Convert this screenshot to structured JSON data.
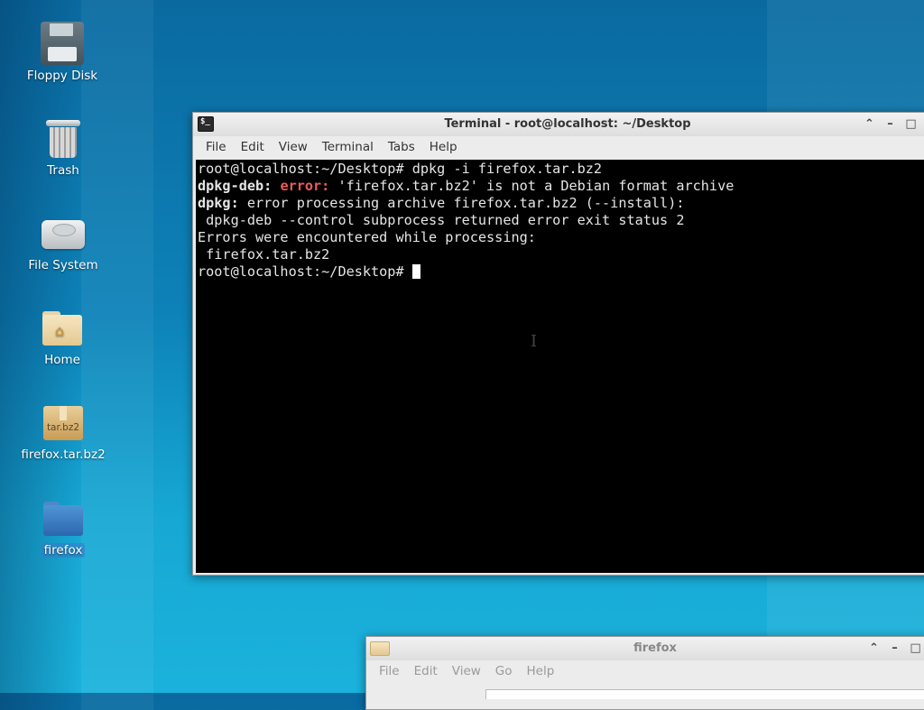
{
  "desktop": {
    "icons": [
      {
        "label": "Floppy Disk",
        "icon": "floppy-disk-icon"
      },
      {
        "label": "Trash",
        "icon": "trash-icon"
      },
      {
        "label": "File System",
        "icon": "hard-drive-icon"
      },
      {
        "label": "Home",
        "icon": "home-folder-icon"
      },
      {
        "label": "firefox.tar.bz2",
        "icon": "archive-icon",
        "badge": "tar.bz2"
      },
      {
        "label": "firefox",
        "icon": "folder-icon"
      }
    ]
  },
  "terminal": {
    "title": "Terminal - root@localhost: ~/Desktop",
    "menu": [
      "File",
      "Edit",
      "View",
      "Terminal",
      "Tabs",
      "Help"
    ],
    "lines": {
      "l1": "root@localhost:~/Desktop# dpkg -i firefox.tar.bz2",
      "l2_prefix": "dpkg-deb:",
      "l2_error": "error:",
      "l2_rest": " 'firefox.tar.bz2' is not a Debian format archive",
      "l3_prefix": "dpkg:",
      "l3_rest": " error processing archive firefox.tar.bz2 (--install):",
      "l4": " dpkg-deb --control subprocess returned error exit status 2",
      "l5": "Errors were encountered while processing:",
      "l6": " firefox.tar.bz2",
      "prompt": "root@localhost:~/Desktop# "
    },
    "colors": {
      "error": "#ef5a5a",
      "background": "#000000",
      "foreground": "#e5e5e5"
    }
  },
  "file_manager": {
    "title": "firefox",
    "menu": [
      "File",
      "Edit",
      "View",
      "Go",
      "Help"
    ]
  },
  "window_controls": {
    "shade": "⌃",
    "minimize": "–",
    "maximize": "□",
    "close": "✕"
  }
}
